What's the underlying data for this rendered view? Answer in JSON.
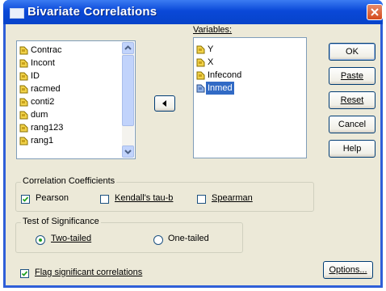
{
  "window": {
    "title": "Bivariate Correlations"
  },
  "source_list": {
    "items": [
      {
        "label": "Contrac"
      },
      {
        "label": "Incont"
      },
      {
        "label": "ID"
      },
      {
        "label": "racmed"
      },
      {
        "label": "conti2"
      },
      {
        "label": "dum"
      },
      {
        "label": "rang123"
      },
      {
        "label": "rang1"
      }
    ]
  },
  "variables": {
    "label": "Variables:",
    "items": [
      {
        "label": "Y",
        "selected": false
      },
      {
        "label": "X",
        "selected": false
      },
      {
        "label": "Infecond",
        "selected": false
      },
      {
        "label": "Inmed",
        "selected": true
      }
    ]
  },
  "buttons": {
    "ok": "OK",
    "paste": "Paste",
    "reset": "Reset",
    "cancel": "Cancel",
    "help": "Help",
    "options": "Options..."
  },
  "correlation_coefficients": {
    "title": "Correlation Coefficients",
    "pearson": {
      "label": "Pearson",
      "checked": true
    },
    "kendall": {
      "label": "Kendall's tau-b",
      "checked": false
    },
    "spearman": {
      "label": "Spearman",
      "checked": false
    }
  },
  "test_of_significance": {
    "title": "Test of Significance",
    "two_tailed": {
      "label": "Two-tailed",
      "selected": true
    },
    "one_tailed": {
      "label": "One-tailed",
      "selected": false
    }
  },
  "flag": {
    "label": "Flag significant correlations",
    "checked": true
  },
  "colors": {
    "title_bar": "#0a48d8",
    "dialog_bg": "#ece9d8",
    "selection": "#316ac5",
    "close_button": "#d54b1d"
  }
}
